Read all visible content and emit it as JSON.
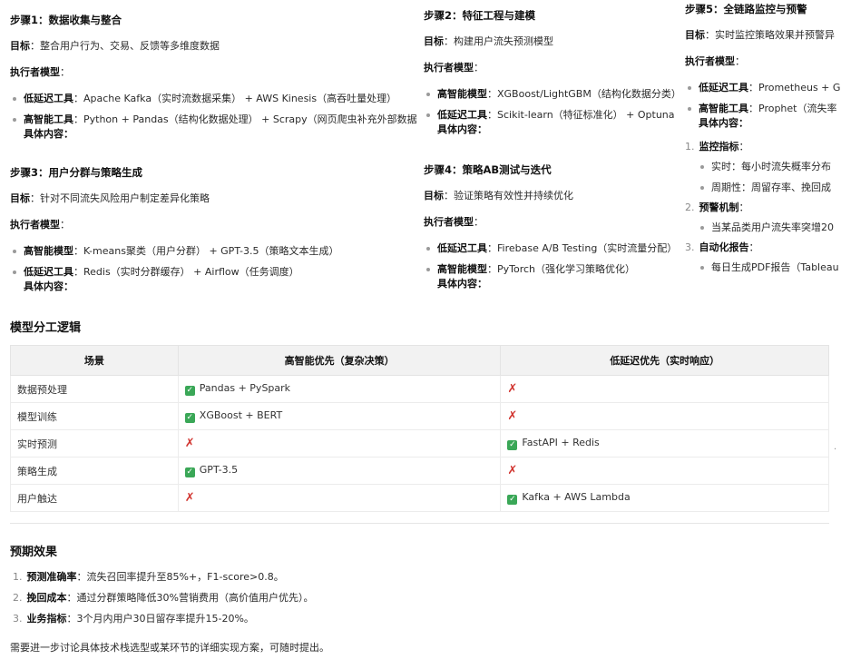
{
  "step1": {
    "title": "步骤1：数据收集与整合",
    "goal_label": "目标",
    "goal_text": "：整合用户行为、交易、反馈等多维度数据",
    "executor_label": "执行者模型",
    "colon": "：",
    "items": [
      {
        "label": "低延迟工具",
        "text": "：Apache Kafka（实时流数据采集） + AWS Kinesis（高吞吐量处理）"
      },
      {
        "label": "高智能工具",
        "text": "：Python + Pandas（结构化数据处理） + Scrapy（网页爬虫补充外部数据"
      }
    ],
    "content_label": "具体内容："
  },
  "step2": {
    "title": "步骤2：特征工程与建模",
    "goal_label": "目标",
    "goal_text": "：构建用户流失预测模型",
    "executor_label": "执行者模型",
    "colon": "：",
    "items": [
      {
        "label": "高智能模型",
        "text": "：XGBoost/LightGBM（结构化数据分类）"
      },
      {
        "label": "低延迟工具",
        "text": "：Scikit-learn（特征标准化） + Optuna（"
      }
    ],
    "content_label": "具体内容："
  },
  "step3": {
    "title": "步骤3：用户分群与策略生成",
    "goal_label": "目标",
    "goal_text": "：针对不同流失风险用户制定差异化策略",
    "executor_label": "执行者模型",
    "colon": "：",
    "items": [
      {
        "label": "高智能模型",
        "text": "：K-means聚类（用户分群） + GPT-3.5（策略文本生成）"
      },
      {
        "label": "低延迟工具",
        "text": "：Redis（实时分群缓存） + Airflow（任务调度）"
      }
    ],
    "content_label": "具体内容："
  },
  "step4": {
    "title": "步骤4：策略AB测试与迭代",
    "goal_label": "目标",
    "goal_text": "：验证策略有效性并持续优化",
    "executor_label": "执行者模型",
    "colon": "：",
    "items": [
      {
        "label": "低延迟工具",
        "text": "：Firebase A/B Testing（实时流量分配）"
      },
      {
        "label": "高智能模型",
        "text": "：PyTorch（强化学习策略优化）"
      }
    ],
    "content_label": "具体内容："
  },
  "step5": {
    "title": "步骤5：全链路监控与预警",
    "goal_label": "目标",
    "goal_text": "：实时监控策略效果并预警异",
    "executor_label": "执行者模型",
    "colon": "：",
    "items": [
      {
        "label": "低延迟工具",
        "text": "：Prometheus + Gra"
      },
      {
        "label": "高智能工具",
        "text": "：Prophet（流失率"
      }
    ],
    "content_label": "具体内容：",
    "sections": [
      {
        "num": "1.",
        "label": "监控指标",
        "colon": "：",
        "bullets": [
          "实时：每小时流失概率分布",
          "周期性：周留存率、挽回成"
        ]
      },
      {
        "num": "2.",
        "label": "预警机制",
        "colon": "：",
        "bullets": [
          "当某品类用户流失率突增20"
        ]
      },
      {
        "num": "3.",
        "label": "自动化报告",
        "colon": "：",
        "bullets": [
          "每日生成PDF报告（Tableau"
        ]
      }
    ]
  },
  "model_section": {
    "title": "模型分工逻辑",
    "headers": [
      "场景",
      "高智能优先（复杂决策）",
      "低延迟优先（实时响应）"
    ],
    "rows": [
      {
        "scene": "数据预处理",
        "high": "Pandas + PySpark",
        "high_ok": true,
        "low": "",
        "low_ok": false
      },
      {
        "scene": "模型训练",
        "high": "XGBoost + BERT",
        "high_ok": true,
        "low": "",
        "low_ok": false
      },
      {
        "scene": "实时预测",
        "high": "",
        "high_ok": false,
        "low": "FastAPI + Redis",
        "low_ok": true
      },
      {
        "scene": "策略生成",
        "high": "GPT-3.5",
        "high_ok": true,
        "low": "",
        "low_ok": false
      },
      {
        "scene": "用户触达",
        "high": "",
        "high_ok": false,
        "low": "Kafka + AWS Lambda",
        "low_ok": true
      }
    ],
    "check_glyph": "✓",
    "cross_glyph": "✗",
    "check_color": "#3aa757",
    "cross_color": "#d1342f"
  },
  "expected": {
    "title": "预期效果",
    "items": [
      {
        "num": "1.",
        "label": "预测准确率",
        "text": "：流失召回率提升至85%+，F1-score>0.8。"
      },
      {
        "num": "2.",
        "label": "挽回成本",
        "text": "：通过分群策略降低30%营销费用（高价值用户优先）。"
      },
      {
        "num": "3.",
        "label": "业务指标",
        "text": "：3个月内用户30日留存率提升15-20%。"
      }
    ]
  },
  "footer": "需要进一步讨论具体技术栈选型或某环节的详细实现方案，可随时提出。",
  "stray_mark": "."
}
